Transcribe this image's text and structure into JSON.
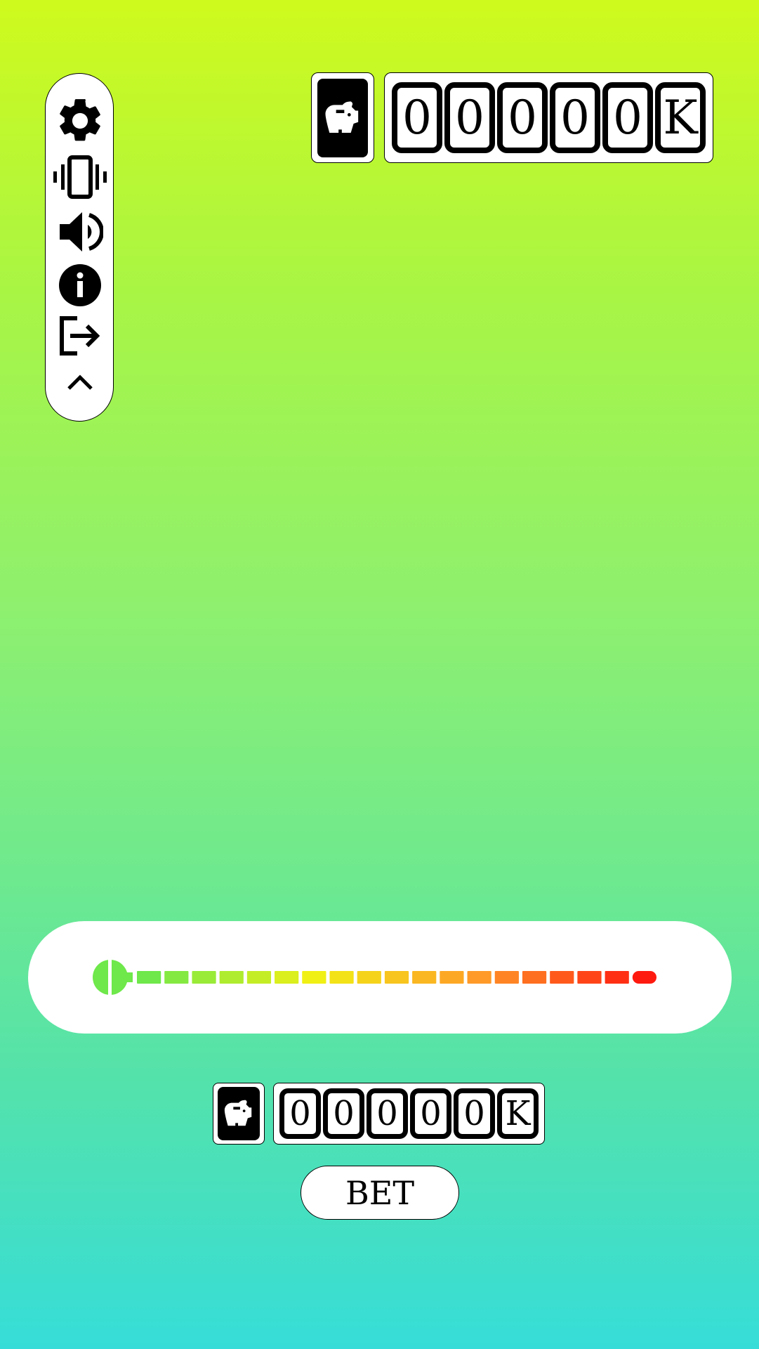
{
  "menu": {
    "items": [
      {
        "name": "settings-button",
        "icon": "gear-icon"
      },
      {
        "name": "vibration-button",
        "icon": "vibration-icon"
      },
      {
        "name": "sound-button",
        "icon": "volume-icon"
      },
      {
        "name": "info-button",
        "icon": "info-icon"
      },
      {
        "name": "exit-button",
        "icon": "logout-icon"
      },
      {
        "name": "collapse-menu-button",
        "icon": "chevron-up-icon"
      }
    ]
  },
  "balance": {
    "icon": "piggy-bank-icon",
    "digits": [
      "0",
      "0",
      "0",
      "0",
      "0",
      "K"
    ]
  },
  "bet": {
    "icon": "piggy-bank-icon",
    "digits": [
      "0",
      "0",
      "0",
      "0",
      "0",
      "K"
    ],
    "slider_level": 0,
    "slider_colors": [
      "#6ee84a",
      "#f0f014",
      "#ff9a28",
      "#ff1a10"
    ],
    "button_label": "BET"
  }
}
